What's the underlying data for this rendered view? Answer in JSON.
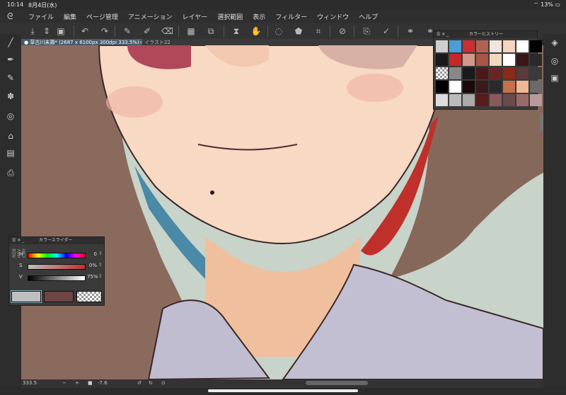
{
  "statusbar": {
    "time": "10:14",
    "date": "8月4日(水)",
    "battery": "13%"
  },
  "menu": [
    "ファイル",
    "編集",
    "ページ管理",
    "アニメーション",
    "レイヤー",
    "選択範囲",
    "表示",
    "フィルター",
    "ウィンドウ",
    "ヘルプ"
  ],
  "tabs": [
    {
      "label": "● 草古川未鶏* (2687 x 6100px 300dpi 333.5%)",
      "active": true
    },
    {
      "label": "× イラスト22",
      "active": false
    }
  ],
  "color_history": {
    "title": "カラーヒストリー",
    "colors": [
      "#cfcfcf",
      "#4a9fd8",
      "#c92f2f",
      "#b06355",
      "#f2e3dc",
      "#f6d4bd",
      "#ffffff",
      "#000000",
      "#1a1a1a",
      "#c62828",
      "#d3988a",
      "#a85645",
      "#f2d7c0",
      "#ffffff",
      "#3a1616",
      "#2a2a2a",
      "checker",
      "#888888",
      "#1a1a1a",
      "#4a1a1a",
      "#6a2424",
      "#8a2a1a",
      "#5a3a3a",
      "#3a3a3a",
      "#000000",
      "#ffffff",
      "#1a0a0a",
      "#3a1a1a",
      "#2a2a2a",
      "#c8704a",
      "#f0b890",
      "#6a6a6a",
      "#dcdcdc",
      "#bbbbbb",
      "#aaaaaa",
      "#5a1a1a",
      "#8a5a5a",
      "#6a4a4a",
      "#9a6a6a",
      "#b89a9a"
    ]
  },
  "color_slider": {
    "title": "カラースライダー",
    "modes": [
      "RGB",
      "HSV",
      "CMY"
    ],
    "rows": [
      {
        "label": "H",
        "value": "0"
      },
      {
        "label": "S",
        "value": "0%"
      },
      {
        "label": "V",
        "value": "75%"
      }
    ],
    "main_color": "#bfbfbf",
    "sub_color": "#6e4545"
  },
  "bottombar": {
    "zoom": "333.5",
    "angle": "-7.6"
  }
}
